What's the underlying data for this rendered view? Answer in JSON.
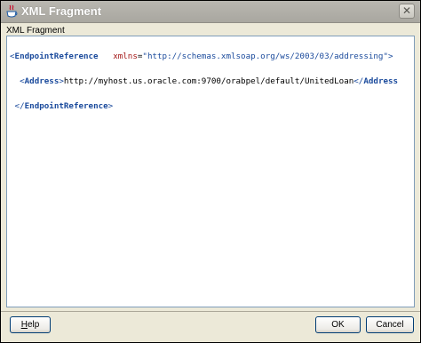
{
  "window": {
    "title": "XML Fragment",
    "close_glyph": "✕"
  },
  "section": {
    "label": "XML Fragment"
  },
  "xml_lines": {
    "line1": {
      "open": "<",
      "tag": "EndpointReference",
      "spacer": "   ",
      "attr_name": "xmlns",
      "eq": "=",
      "attr_value": "\"http://schemas.xmlsoap.org/ws/2003/03/addressing\"",
      "close": ">"
    },
    "line2": {
      "indent": "  ",
      "open": "<",
      "tag": "Address",
      "close": ">",
      "text": "http://myhost.us.oracle.com:9700/orabpel/default/UnitedLoan",
      "end_open": "</",
      "end_tag": "Address"
    },
    "line3": {
      "indent": " ",
      "end_open": "</",
      "tag": "EndpointReference",
      "close": ">"
    }
  },
  "buttons": {
    "help": {
      "mnemonic": "H",
      "rest": "elp"
    },
    "ok": "OK",
    "cancel": "Cancel"
  },
  "icons": {
    "app": "java-cup-icon",
    "close": "close-icon"
  }
}
